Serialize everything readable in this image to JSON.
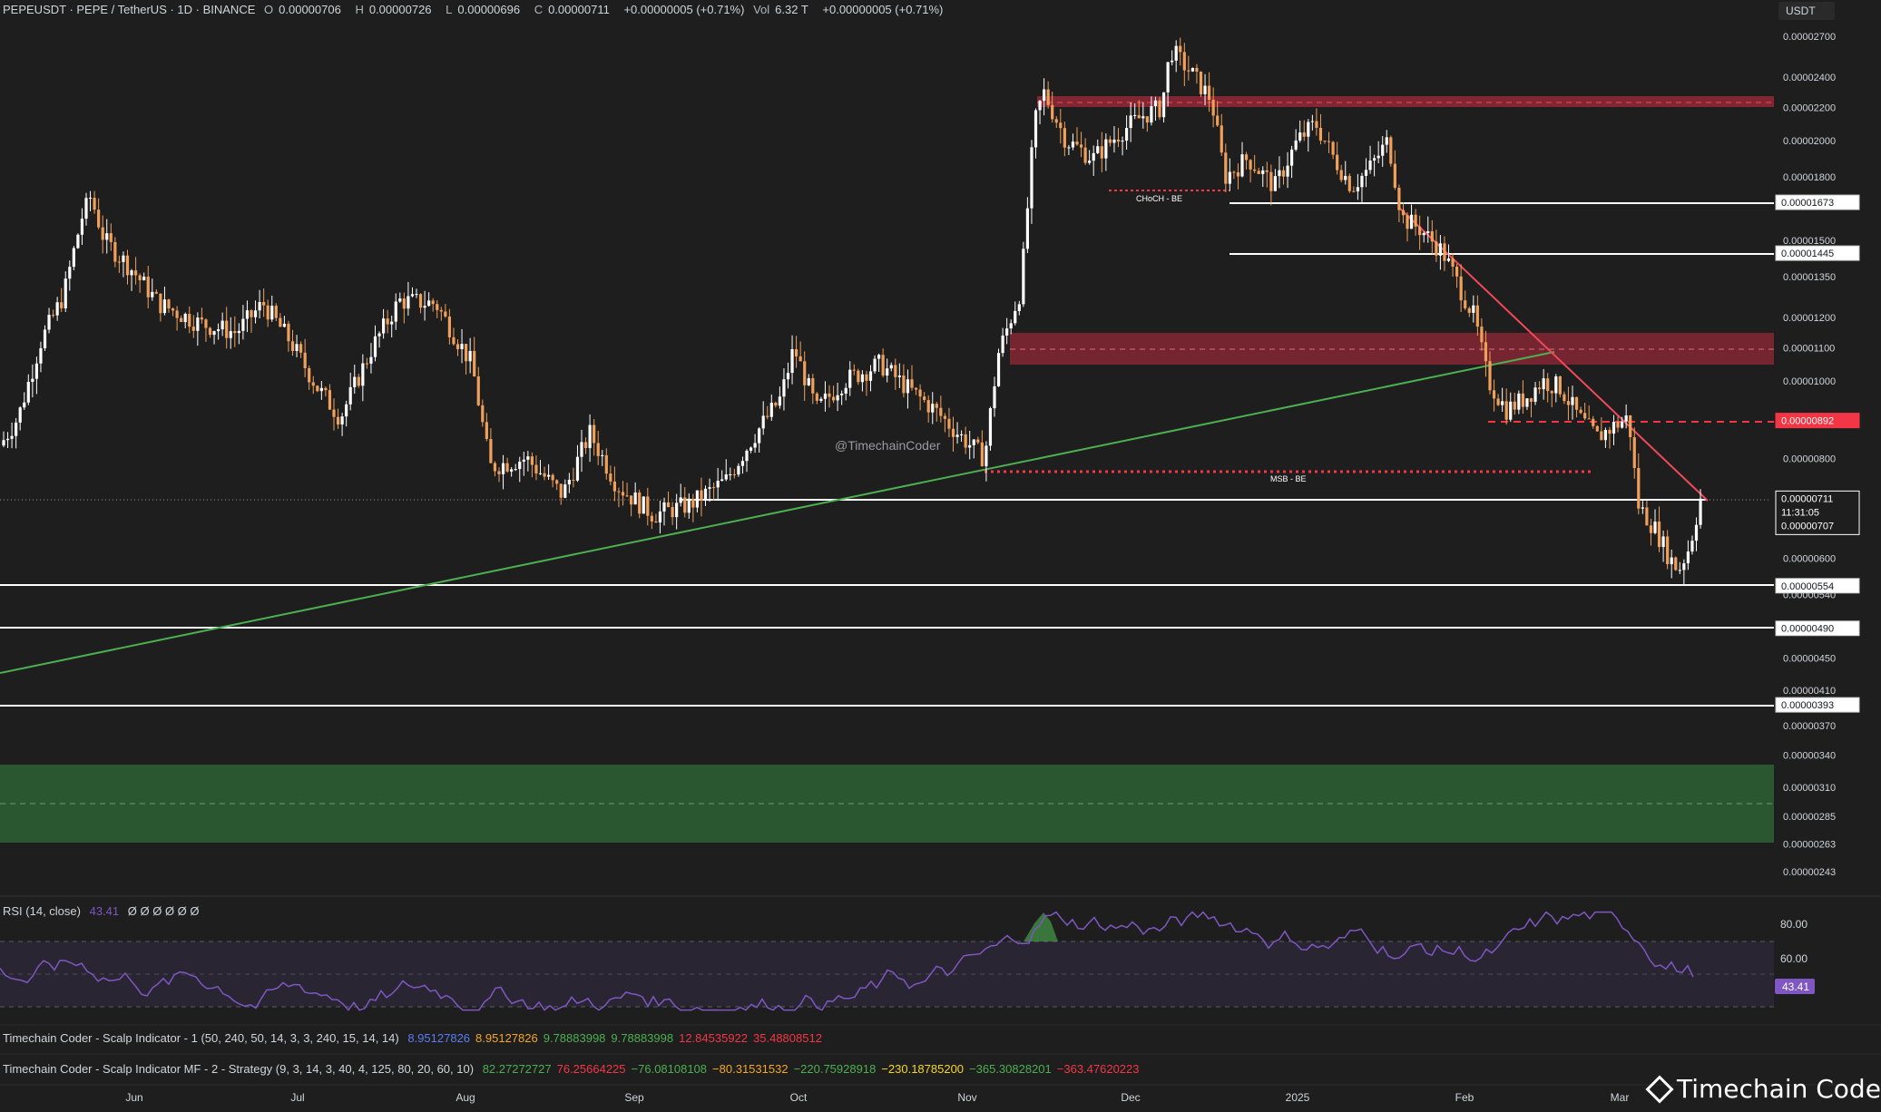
{
  "header": {
    "symbol": "PEPEUSDT · PEPE / TetherUS · 1D · BINANCE",
    "o_label": "O",
    "o_value": "0.00000706",
    "h_label": "H",
    "h_value": "0.00000726",
    "l_label": "L",
    "l_value": "0.00000696",
    "c_label": "C",
    "c_value": "0.00000711",
    "change": "+0.00000005 (+0.71%)",
    "vol_label": "Vol",
    "vol_value": "6.32 T",
    "vol_change": "+0.00000005 (+0.71%)"
  },
  "currency_button": "USDT",
  "watermark": "@TimechainCoder",
  "brand": "Timechain Coder",
  "colors": {
    "up": "#ffffff",
    "down": "#f0a05a",
    "background": "#1e1e1e",
    "resistance_zone": "#a3293a",
    "demand_zone": "#2f6b35",
    "trendline_up": "#4caf50",
    "trendline_down": "#f04a5a",
    "rsi_line": "#7e57c2",
    "red_level": "#f23645"
  },
  "chart_data": {
    "type": "candlestick",
    "scale": "log",
    "y_ticks": [
      "0.00002700",
      "0.00002400",
      "0.00002200",
      "0.00002000",
      "0.00001800",
      "0.00001500",
      "0.00001350",
      "0.00001200",
      "0.00001100",
      "0.00001000",
      "0.00000800",
      "0.00000600",
      "0.00000540",
      "0.00000450",
      "0.00000410",
      "0.00000370",
      "0.00000340",
      "0.00000310",
      "0.00000285",
      "0.00000263",
      "0.00000243"
    ],
    "x_ticks": [
      "Jun",
      "Jul",
      "Aug",
      "Sep",
      "Oct",
      "Nov",
      "Dec",
      "2025",
      "Feb",
      "Mar"
    ],
    "last_price_label": "0.00000711",
    "countdown_label": "11:31:05",
    "open_price_label": "0.00000707",
    "level_labels": [
      {
        "price": "0.00001673",
        "style": "white"
      },
      {
        "price": "0.00001445",
        "style": "white"
      },
      {
        "price": "0.00000892",
        "style": "red"
      },
      {
        "price": "0.00000554",
        "style": "white"
      },
      {
        "price": "0.00000490",
        "style": "white"
      },
      {
        "price": "0.00000393",
        "style": "white"
      }
    ],
    "annotations": [
      "CHoCH - BE",
      "MSB - BE"
    ],
    "zones": [
      {
        "name": "upper resistance",
        "low": 2.18e-05,
        "high": 2.27e-05
      },
      {
        "name": "mid resistance",
        "low": 1.05e-05,
        "high": 1.14e-05
      },
      {
        "name": "demand",
        "low": 2.6e-06,
        "high": 3.3e-06
      }
    ],
    "rsi": {
      "label": "RSI (14, close)",
      "value": "43.41",
      "placeholders": "Ø Ø Ø Ø Ø Ø",
      "ticks": [
        "80.00",
        "60.00"
      ],
      "current_label": "43.41"
    },
    "indicator1": {
      "label": "Timechain Coder - Scalp Indicator - 1 (50, 240, 50, 14, 3, 3, 240, 15, 14, 14)",
      "values": [
        {
          "v": "8.95127826",
          "color": "#5b7cf5"
        },
        {
          "v": "8.95127826",
          "color": "#f5a623"
        },
        {
          "v": "9.78883998",
          "color": "#4caf50"
        },
        {
          "v": "9.78883998",
          "color": "#4caf50"
        },
        {
          "v": "12.84535922",
          "color": "#f23645"
        },
        {
          "v": "35.48808512",
          "color": "#f23645"
        }
      ]
    },
    "indicator2": {
      "label": "Timechain Coder - Scalp Indicator MF - 2 - Strategy (9, 3, 14, 3, 40, 4, 125, 80, 20, 60, 10)",
      "values": [
        {
          "v": "82.27272727",
          "color": "#4caf50"
        },
        {
          "v": "76.25664225",
          "color": "#f23645"
        },
        {
          "v": "−76.08108108",
          "color": "#4caf50"
        },
        {
          "v": "−80.31531532",
          "color": "#f5a623"
        },
        {
          "v": "−220.75928918",
          "color": "#4caf50"
        },
        {
          "v": "−230.18785200",
          "color": "#f5d623"
        },
        {
          "v": "−365.30828201",
          "color": "#4caf50"
        },
        {
          "v": "−363.47620223",
          "color": "#f23645"
        }
      ]
    }
  }
}
